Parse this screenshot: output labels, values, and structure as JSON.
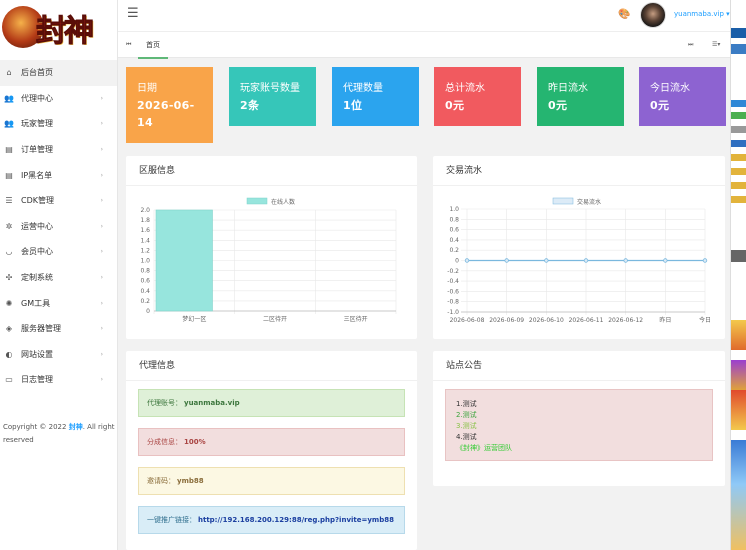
{
  "sidebar": {
    "items": [
      {
        "label": "后台首页",
        "icon": "⌂"
      },
      {
        "label": "代理中心",
        "icon": "👥"
      },
      {
        "label": "玩家管理",
        "icon": "👥"
      },
      {
        "label": "订单管理",
        "icon": "▤"
      },
      {
        "label": "IP黑名单",
        "icon": "▤"
      },
      {
        "label": "CDK管理",
        "icon": "☰"
      },
      {
        "label": "运营中心",
        "icon": "✲"
      },
      {
        "label": "会员中心",
        "icon": "◡"
      },
      {
        "label": "定制系统",
        "icon": "✣"
      },
      {
        "label": "GM工具",
        "icon": "✺"
      },
      {
        "label": "服务器管理",
        "icon": "◈"
      },
      {
        "label": "网站设置",
        "icon": "◐"
      },
      {
        "label": "日志管理",
        "icon": "▭"
      }
    ],
    "arrow": "›",
    "copyright_prefix": "Copyright © 2022",
    "copyright_brand": "封神",
    "copyright_suffix": ". All right reserved"
  },
  "topbar": {
    "menu_icon": "☰",
    "theme_icon": "🎨",
    "username": "yuanmaba.vip ▾"
  },
  "tabs": {
    "prev": "⏮",
    "home": "首页",
    "next": "⏭",
    "more": "☰▾"
  },
  "stats": [
    {
      "label": "日期",
      "value": "2026-06-14",
      "color": "#f9a449"
    },
    {
      "label": "玩家账号数量",
      "value": "2条",
      "color": "#36c6b9"
    },
    {
      "label": "代理数量",
      "value": "1位",
      "color": "#2ba4ee"
    },
    {
      "label": "总计流水",
      "value": "0元",
      "color": "#f15a5f"
    },
    {
      "label": "昨日流水",
      "value": "0元",
      "color": "#25b571"
    },
    {
      "label": "今日流水",
      "value": "0元",
      "color": "#8d63d1"
    }
  ],
  "server_card": {
    "title": "区服信息"
  },
  "trade_card": {
    "title": "交易流水"
  },
  "agent_card": {
    "title": "代理信息",
    "account_label": "代理账号：",
    "account": "yuanmaba.vip",
    "share_label": "分成信息：",
    "share": "100%",
    "invite_label": "邀请码：",
    "invite": "ymb88",
    "link_label": "一键推广链接：",
    "link": "http://192.168.200.129:88/reg.php?invite=ymb88"
  },
  "notice_card": {
    "title": "站点公告",
    "lines": [
      "1.测试",
      "2.测试",
      "3.测试",
      "4.测试",
      "《封神》运营团队"
    ],
    "line_colors": [
      "#333333",
      "#3ca53c",
      "#8bc34a",
      "#333333",
      "#33cc33"
    ]
  },
  "logo": {
    "text": "封神"
  },
  "chart_data": [
    {
      "type": "bar",
      "legend": [
        "在线人数"
      ],
      "categories": [
        "梦幻一区",
        "二区待开",
        "三区待开"
      ],
      "series": [
        {
          "name": "在线人数",
          "values": [
            2,
            0,
            0
          ]
        }
      ],
      "ylim": [
        0,
        2
      ],
      "yticks": [
        "0",
        "0.2",
        "0.4",
        "0.6",
        "0.8",
        "1.0",
        "1.2",
        "1.4",
        "1.6",
        "1.8",
        "2.0"
      ],
      "color": "#97e5dd",
      "grid": true,
      "legend_position": "top"
    },
    {
      "type": "line",
      "legend": [
        "交易流水"
      ],
      "categories": [
        "2026-06-08",
        "2026-06-09",
        "2026-06-10",
        "2026-06-11",
        "2026-06-12",
        "昨日",
        "今日"
      ],
      "series": [
        {
          "name": "交易流水",
          "values": [
            0,
            0,
            0,
            0,
            0,
            0,
            0
          ]
        }
      ],
      "ylim": [
        -1,
        1
      ],
      "yticks": [
        "1.0",
        "0.8",
        "0.6",
        "0.4",
        "0.2",
        "0",
        "-0.2",
        "-0.4",
        "-0.6",
        "-0.8",
        "-1.0"
      ],
      "color": "#7ab8de",
      "grid": true,
      "legend_position": "top"
    }
  ]
}
